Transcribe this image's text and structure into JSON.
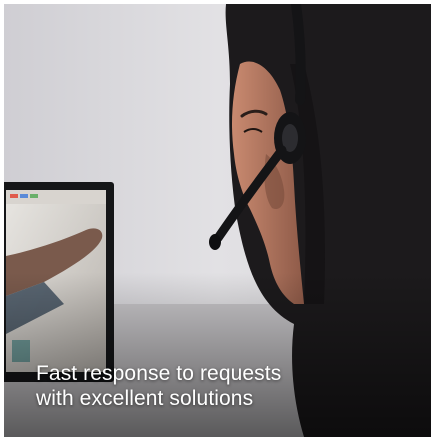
{
  "caption": {
    "line1": "Fast response to requests",
    "line2": "with excellent solutions"
  },
  "colors": {
    "background": "#d9d8dc",
    "hair": "#1c1a1c",
    "skin": "#b0765f",
    "headset": "#141416",
    "monitor_frame": "#151618",
    "caption_text": "#ffffff"
  },
  "icons": {
    "headset": "headset-icon"
  }
}
